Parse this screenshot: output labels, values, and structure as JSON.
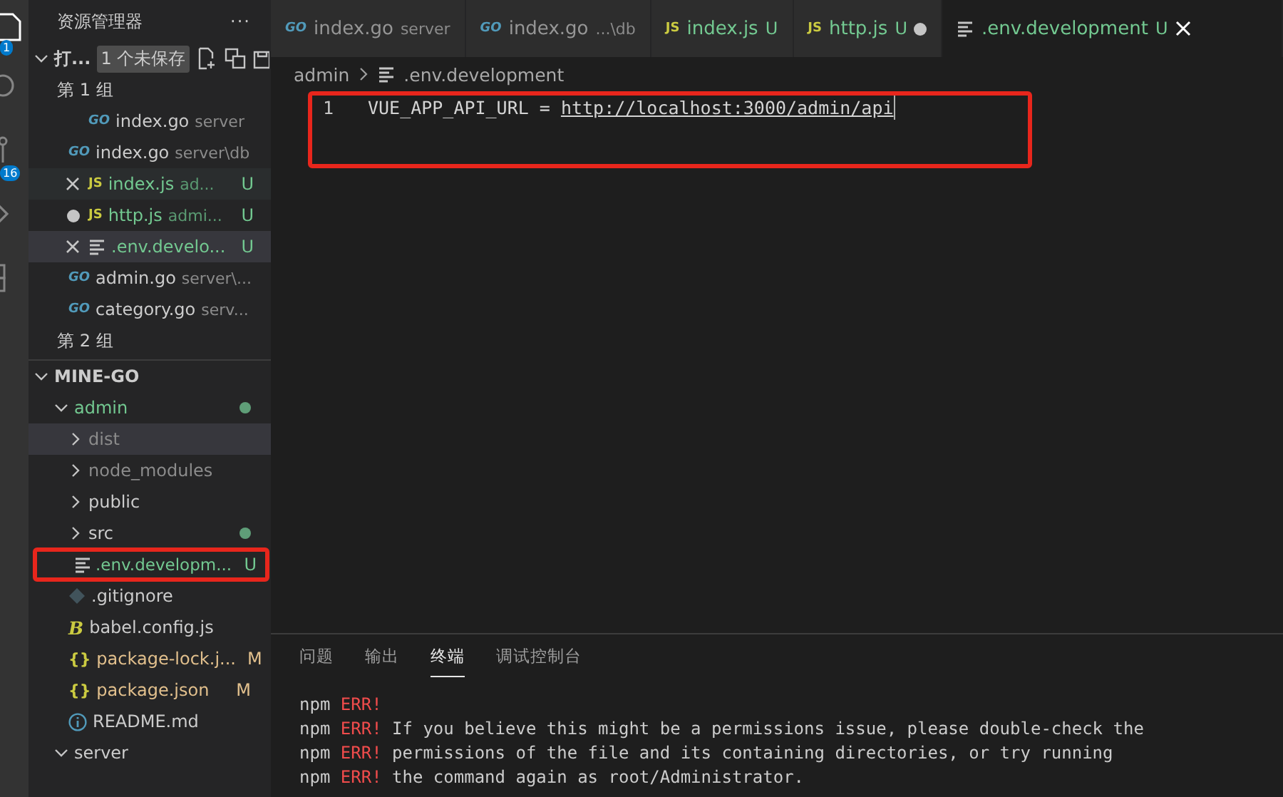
{
  "activity_bar": {
    "items": [
      {
        "kind": "files",
        "badge": "1"
      },
      {
        "kind": "search"
      },
      {
        "kind": "scm",
        "badge": "16"
      },
      {
        "kind": "run"
      },
      {
        "kind": "extensions"
      }
    ]
  },
  "sidebar": {
    "title": "资源管理器",
    "more": "···",
    "open_editors": {
      "title": "打...",
      "expanded": true,
      "unsaved_badge": "1 个未保存",
      "groups": [
        {
          "label": "第 1 组",
          "items": [
            {
              "kind": "go",
              "icon": "GO",
              "name": "index.go",
              "description": "server",
              "selected": false,
              "hover": false,
              "dirty": false
            },
            {
              "kind": "go",
              "icon": "GO",
              "name": "index.go",
              "description": "server\\db",
              "selected": false,
              "hover": false,
              "dirty": false
            },
            {
              "kind": "js",
              "icon": "JS",
              "name": "index.js",
              "description": "ad...",
              "status": "U",
              "selected": false,
              "hover": true,
              "dirty": false
            },
            {
              "kind": "js",
              "icon": "JS",
              "name": "http.js",
              "description": "admi...",
              "status": "U",
              "selected": false,
              "hover": false,
              "dirty": true
            },
            {
              "kind": "env",
              "name": ".env.develo...",
              "status": "U",
              "selected": true,
              "hover": false,
              "dirty": false
            },
            {
              "kind": "go",
              "icon": "GO",
              "name": "admin.go",
              "description": "server\\...",
              "selected": false,
              "hover": false,
              "dirty": false
            },
            {
              "kind": "go",
              "icon": "GO",
              "name": "category.go",
              "description": "serv...",
              "selected": false,
              "hover": false,
              "dirty": false
            }
          ]
        },
        {
          "label": "第 2 组"
        }
      ]
    },
    "folder": {
      "title": "MINE-GO",
      "expanded": true,
      "tree": [
        {
          "kind": "folder",
          "name": "admin",
          "expanded": true,
          "has_changes": true,
          "color": "#73c991",
          "children": [
            {
              "kind": "folder",
              "name": "dist",
              "expanded": false,
              "dimmed": true,
              "selected": true
            },
            {
              "kind": "folder",
              "name": "node_modules",
              "expanded": false,
              "dimmed": true,
              "selected": false
            },
            {
              "kind": "folder",
              "name": "public",
              "expanded": false,
              "dimmed": false,
              "selected": false
            },
            {
              "kind": "folder",
              "name": "src",
              "expanded": false,
              "dimmed": false,
              "selected": false,
              "has_changes": true
            },
            {
              "kind": "env",
              "name": ".env.developm...",
              "status": "U",
              "color": "#73c991",
              "annotated": true
            },
            {
              "kind": "git",
              "name": ".gitignore"
            },
            {
              "kind": "babel",
              "icon": "B",
              "name": "babel.config.js"
            },
            {
              "kind": "json",
              "icon": "{}",
              "name": "package-lock.j...",
              "status": "M",
              "color": "#e2c08d"
            },
            {
              "kind": "json",
              "icon": "{}",
              "name": "package.json",
              "status": "M",
              "color": "#e2c08d"
            },
            {
              "kind": "info",
              "name": "README.md"
            }
          ]
        },
        {
          "kind": "folder",
          "name": "server",
          "expanded": true
        }
      ]
    }
  },
  "tabs": [
    {
      "kind": "go",
      "icon": "GO",
      "name": "index.go",
      "description": "server",
      "selected": false,
      "dirty": false
    },
    {
      "kind": "go",
      "icon": "GO",
      "name": "index.go",
      "description": "...\\db",
      "selected": false,
      "dirty": false
    },
    {
      "kind": "js",
      "icon": "JS",
      "name": "index.js",
      "status": "U",
      "selected": false,
      "dirty": false
    },
    {
      "kind": "js",
      "icon": "JS",
      "name": "http.js",
      "status": "U",
      "selected": false,
      "dirty": true
    },
    {
      "kind": "env",
      "name": ".env.development",
      "status": "U",
      "selected": true,
      "dirty": false
    }
  ],
  "breadcrumb": [
    "admin",
    ".env.development"
  ],
  "editor": {
    "lines": [
      {
        "number": "1",
        "key": "VUE_APP_API_URL",
        "operator": "=",
        "value": "http://localhost:3000/admin/api"
      }
    ],
    "annotated": true
  },
  "panel": {
    "tabs": [
      {
        "label": "问题",
        "selected": false
      },
      {
        "label": "输出",
        "selected": false
      },
      {
        "label": "终端",
        "selected": true
      },
      {
        "label": "调试控制台",
        "selected": false
      }
    ],
    "terminal": [
      {
        "prefix": "npm",
        "level": "ERR!"
      },
      {
        "prefix": "npm",
        "level": "ERR!",
        "text": "If you believe this might be a permissions issue, please double-check the"
      },
      {
        "prefix": "npm",
        "level": "ERR!",
        "text": "permissions of the file and its containing directories, or try running"
      },
      {
        "prefix": "npm",
        "level": "ERR!",
        "text": "the command again as root/Administrator."
      }
    ]
  }
}
